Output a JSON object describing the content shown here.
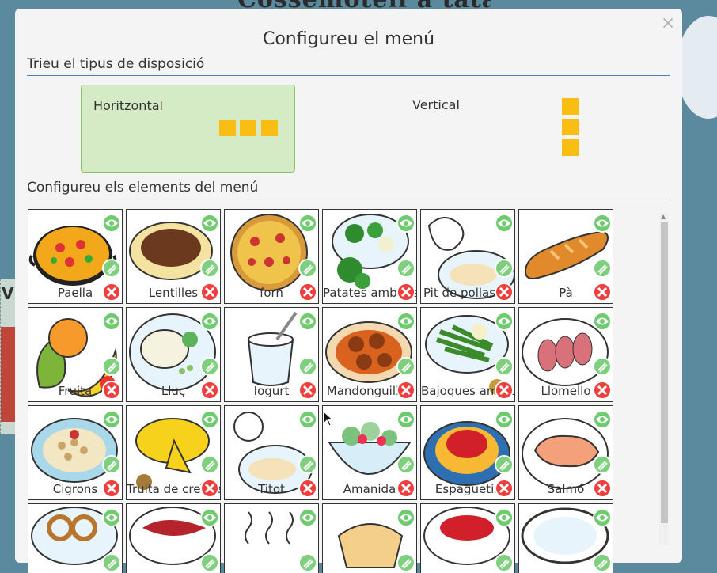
{
  "background": {
    "title_fragment": "Cossemotell a tatal",
    "side_letter": "V"
  },
  "modal": {
    "title": "Configureu el menú",
    "close_label": "×"
  },
  "layout_section": {
    "heading": "Trieu el tipus de disposició",
    "options": [
      {
        "label": "Horitzontal",
        "selected": true,
        "icon": "horizontal-layout-icon"
      },
      {
        "label": "Vertical",
        "selected": false,
        "icon": "vertical-layout-icon"
      }
    ]
  },
  "elements_section": {
    "heading": "Configureu els elements del menú"
  },
  "menu_items": [
    {
      "label": "Paella",
      "icon": "paella-icon"
    },
    {
      "label": "Lentilles",
      "icon": "lentils-icon"
    },
    {
      "label": "forn",
      "icon": "pizza-icon"
    },
    {
      "label": "Patates amb creïlles",
      "icon": "vegetables-icon"
    },
    {
      "label": "Pit de pollastre",
      "icon": "chicken-breast-icon"
    },
    {
      "label": "Pà",
      "icon": "bread-icon"
    },
    {
      "label": "Fruita",
      "icon": "fruit-icon"
    },
    {
      "label": "Lluç",
      "icon": "hake-icon"
    },
    {
      "label": "Iogurt",
      "icon": "yogurt-icon"
    },
    {
      "label": "Mandonguilles",
      "icon": "meatballs-icon"
    },
    {
      "label": "Bajoques amb creïlles",
      "icon": "green-beans-icon"
    },
    {
      "label": "Llomello",
      "icon": "pork-loin-icon"
    },
    {
      "label": "Cigrons",
      "icon": "chickpeas-icon"
    },
    {
      "label": "Truita de creïlles",
      "icon": "omelette-icon"
    },
    {
      "label": "Titot",
      "icon": "turkey-icon"
    },
    {
      "label": "Amanida",
      "icon": "salad-icon"
    },
    {
      "label": "Espaguetis",
      "icon": "spaghetti-icon"
    },
    {
      "label": "Salmó",
      "icon": "salmon-icon"
    },
    {
      "label": "",
      "icon": "pretzel-icon"
    },
    {
      "label": "",
      "icon": "ham-icon"
    },
    {
      "label": "",
      "icon": "soup-icon"
    },
    {
      "label": "",
      "icon": "crepe-icon"
    },
    {
      "label": "",
      "icon": "rice-icon"
    },
    {
      "label": "",
      "icon": "plate-icon"
    }
  ],
  "colors": {
    "selected_bg": "#d5ebc6",
    "accent_line": "#4a7fc1",
    "layout_square": "#f9bd13",
    "eye_button": "#6ecb6e",
    "delete_button": "#ef3e3e"
  }
}
